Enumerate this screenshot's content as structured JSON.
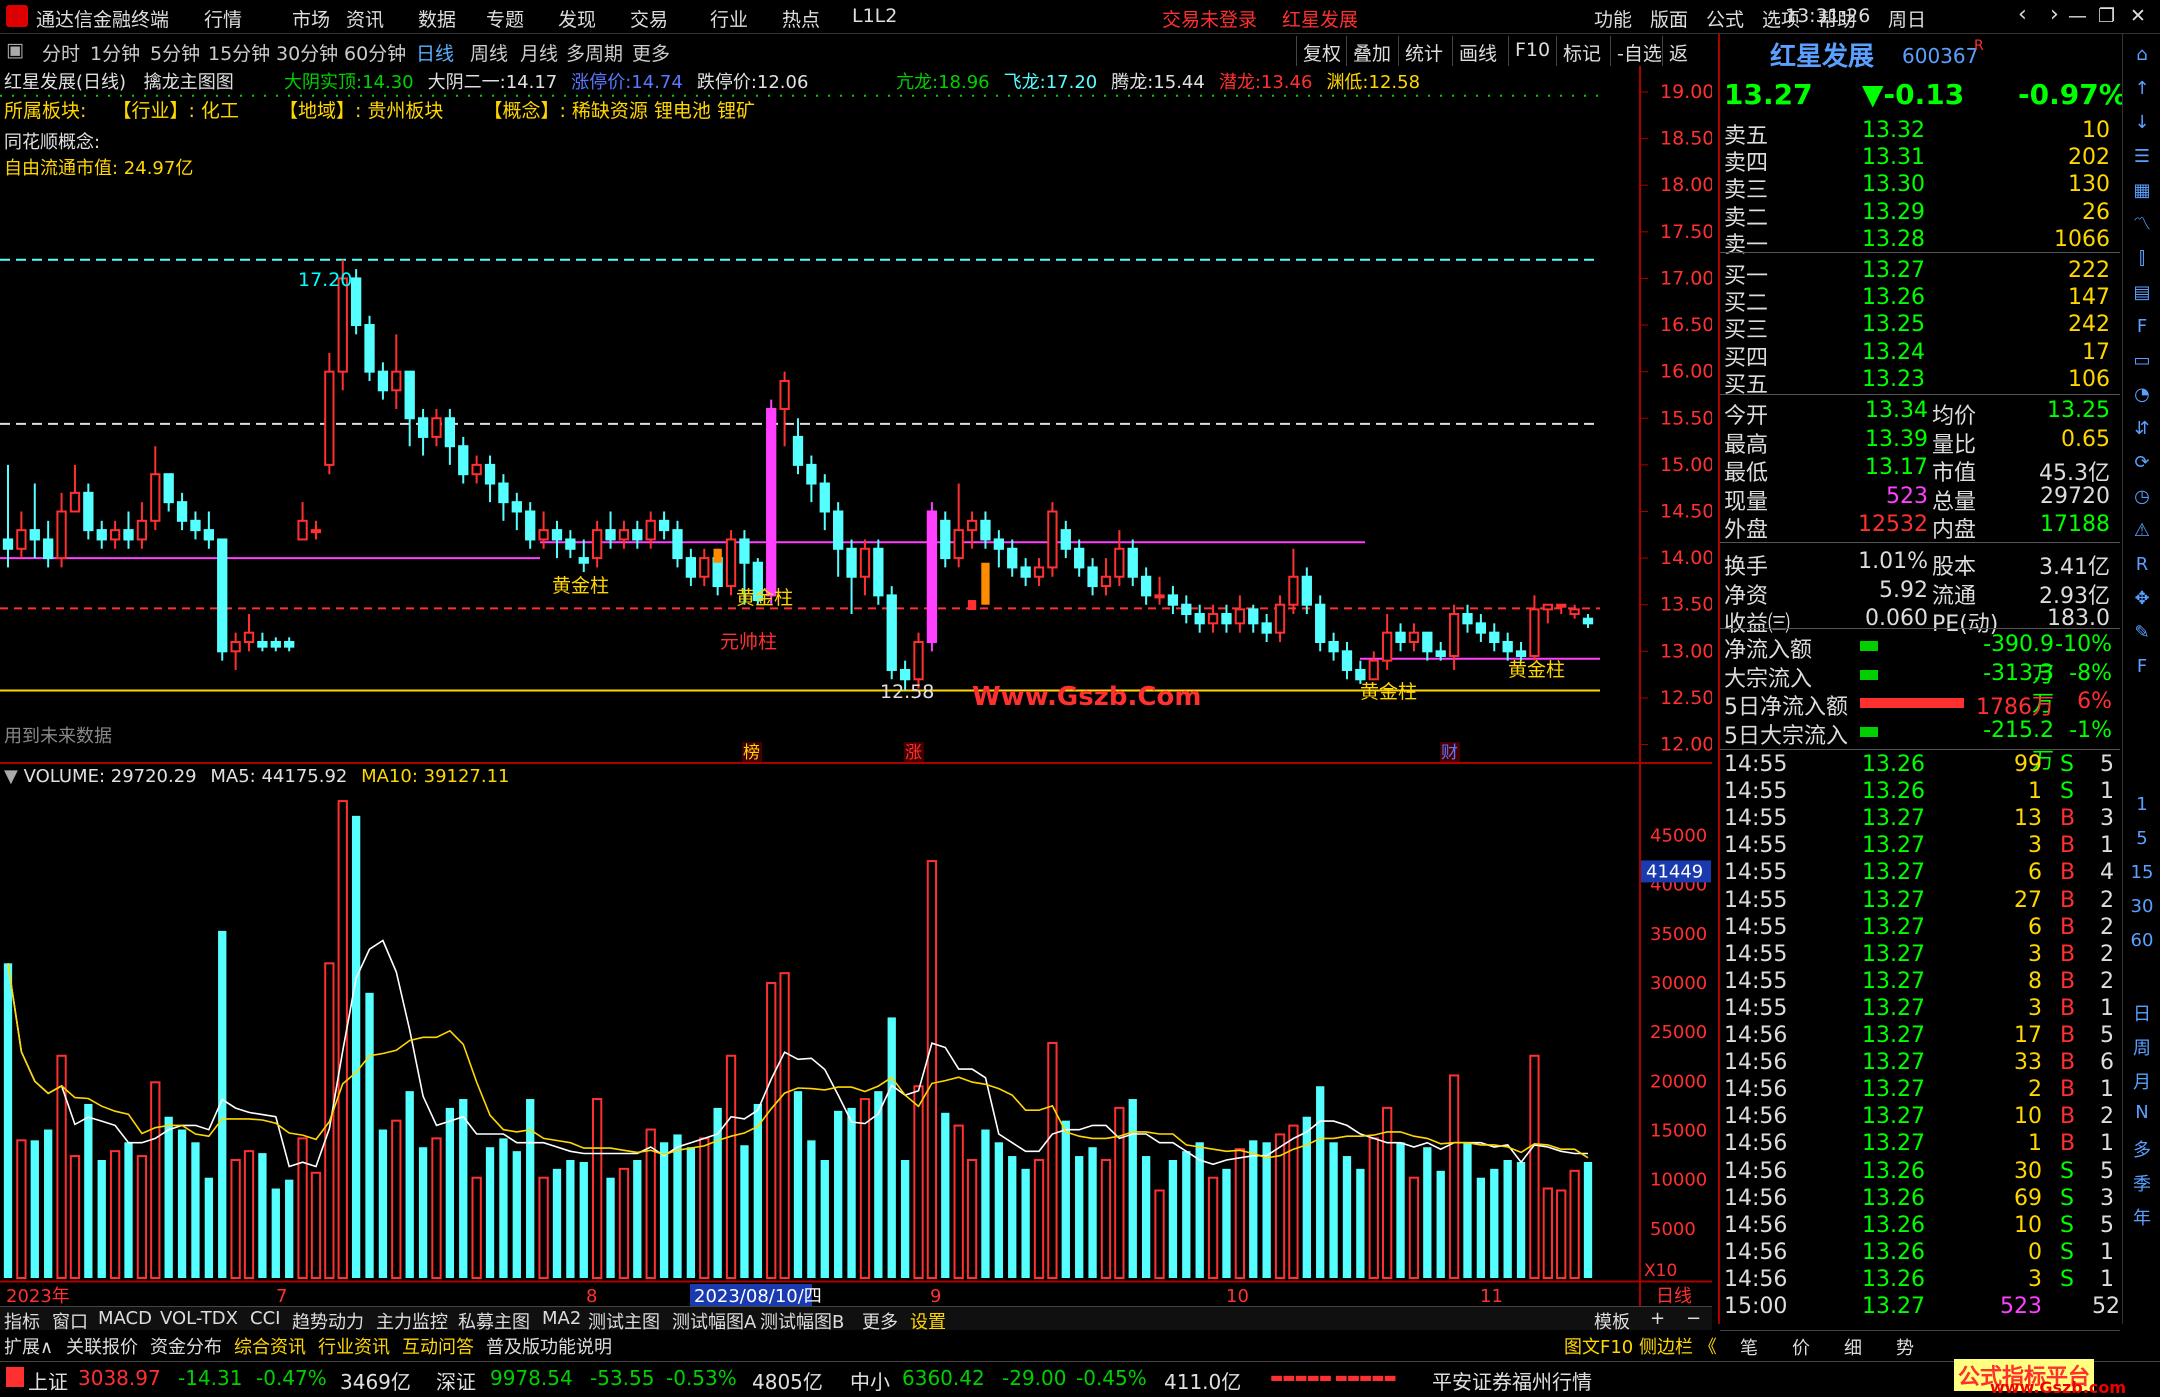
{
  "app": {
    "title": "通达信金融终端",
    "menu": [
      "行情",
      "市场",
      "资讯",
      "数据",
      "专题",
      "发现",
      "交易",
      "行业",
      "热点",
      "L1L2"
    ],
    "login": "交易未登录",
    "stock_tag": "红星发展",
    "right_menu": [
      "功能",
      "版面",
      "公式",
      "选项",
      "帮助"
    ],
    "time": "13:31:26",
    "weekday": "周日"
  },
  "toolbar": {
    "periods": [
      "分时",
      "1分钟",
      "5分钟",
      "15分钟",
      "30分钟",
      "60分钟",
      "日线",
      "周线",
      "月线",
      "多周期",
      "更多"
    ],
    "active": "日线",
    "right": [
      "复权",
      "叠加",
      "统计",
      "画线",
      "F10",
      "标记",
      "-自选",
      "返回"
    ]
  },
  "info": {
    "stock": "红星发展(日线)",
    "mode": "擒龙主图图",
    "line1": [
      {
        "t": "大阴实顶:",
        "v": "14.30",
        "c": "g"
      },
      {
        "t": "大阴二一:",
        "v": "14.17",
        "c": "w"
      },
      {
        "t": "涨停价:",
        "v": "14.74",
        "c": "b"
      },
      {
        "t": "跌停价:",
        "v": "12.06",
        "c": "w"
      }
    ],
    "line1b": [
      {
        "t": "亢龙:",
        "v": "18.96",
        "c": "g"
      },
      {
        "t": "飞龙:",
        "v": "17.20",
        "c": "c"
      },
      {
        "t": "腾龙:",
        "v": "15.44",
        "c": "w"
      },
      {
        "t": "潜龙:",
        "v": "13.46",
        "c": "r"
      },
      {
        "t": "渊低:",
        "v": "12.58",
        "c": "y"
      }
    ],
    "sector_label": "所属板块:",
    "industry": "【行业】: 化工",
    "region": "【地域】: 贵州板块",
    "concept": "【概念】: 稀缺资源 锂电池 锂矿",
    "ths": "同花顺概念:",
    "float_mv": "自由流通市值: 24.97亿",
    "future": "用到未来数据"
  },
  "chart_data": {
    "type": "candlestick",
    "y_ticks": [
      "19.00",
      "18.50",
      "18.00",
      "17.50",
      "17.00",
      "16.50",
      "16.00",
      "15.50",
      "15.00",
      "14.50",
      "14.00",
      "13.50",
      "13.00",
      "12.50",
      "12.00"
    ],
    "ylim": [
      11.92,
      19.15
    ],
    "annotations": [
      "17.20",
      "12.58",
      "黄金柱",
      "黄金柱",
      "元帅柱",
      "黄金柱",
      "黄金柱"
    ],
    "markers": [
      "榜",
      "涨",
      "财"
    ],
    "watermark": "Www.Gszb.Com",
    "volume": {
      "label": "VOLUME: 29720.29",
      "ma5": "MA5: 44175.92",
      "ma10": "MA10: 39127.11",
      "ticks": [
        "45000",
        "40000",
        "35000",
        "30000",
        "25000",
        "20000",
        "15000",
        "10000",
        "5000"
      ],
      "cursor_value": "41449",
      "scale": "X10",
      "ylim": [
        0,
        48000
      ]
    },
    "x_labels": [
      "2023年",
      "7",
      "8",
      "2023/08/10/四",
      "9",
      "10",
      "11",
      "日线"
    ]
  },
  "quote": {
    "name": "红星发展",
    "code": "600367",
    "tag": "R",
    "price": "13.27",
    "change": "▼-0.13",
    "pct": "-0.97%",
    "asks": [
      {
        "l": "卖五",
        "p": "13.32",
        "v": "10"
      },
      {
        "l": "卖四",
        "p": "13.31",
        "v": "202"
      },
      {
        "l": "卖三",
        "p": "13.30",
        "v": "130"
      },
      {
        "l": "卖二",
        "p": "13.29",
        "v": "26"
      },
      {
        "l": "卖一",
        "p": "13.28",
        "v": "1066"
      }
    ],
    "bids": [
      {
        "l": "买一",
        "p": "13.27",
        "v": "222"
      },
      {
        "l": "买二",
        "p": "13.26",
        "v": "147"
      },
      {
        "l": "买三",
        "p": "13.25",
        "v": "242"
      },
      {
        "l": "买四",
        "p": "13.24",
        "v": "17"
      },
      {
        "l": "买五",
        "p": "13.23",
        "v": "106"
      }
    ],
    "stats": [
      [
        "今开",
        "13.34",
        "均价",
        "13.25"
      ],
      [
        "最高",
        "13.39",
        "量比",
        "0.65"
      ],
      [
        "最低",
        "13.17",
        "市值",
        "45.3亿"
      ],
      [
        "现量",
        "523",
        "总量",
        "29720"
      ],
      [
        "外盘",
        "12532",
        "内盘",
        "17188"
      ],
      [
        "换手",
        "1.01%",
        "股本",
        "3.41亿"
      ],
      [
        "净资",
        "5.92",
        "流通",
        "2.93亿"
      ],
      [
        "收益㈢",
        "0.060",
        "PE(动)",
        "183.0"
      ]
    ],
    "flows": [
      [
        "净流入额",
        "-390.9万",
        "-10%"
      ],
      [
        "大宗流入",
        "-313.3万",
        "-8%"
      ],
      [
        "5日净流入额",
        "1786万",
        "6%"
      ],
      [
        "5日大宗流入",
        "-215.2万",
        "-1%"
      ]
    ],
    "ticks": [
      [
        "14:55",
        "13.26",
        "99",
        "S",
        "5"
      ],
      [
        "14:55",
        "13.26",
        "1",
        "S",
        "1"
      ],
      [
        "14:55",
        "13.27",
        "13",
        "B",
        "3"
      ],
      [
        "14:55",
        "13.27",
        "3",
        "B",
        "1"
      ],
      [
        "14:55",
        "13.27",
        "6",
        "B",
        "4"
      ],
      [
        "14:55",
        "13.27",
        "27",
        "B",
        "2"
      ],
      [
        "14:55",
        "13.27",
        "6",
        "B",
        "2"
      ],
      [
        "14:55",
        "13.27",
        "3",
        "B",
        "2"
      ],
      [
        "14:55",
        "13.27",
        "8",
        "B",
        "2"
      ],
      [
        "14:55",
        "13.27",
        "3",
        "B",
        "1"
      ],
      [
        "14:56",
        "13.27",
        "17",
        "B",
        "5"
      ],
      [
        "14:56",
        "13.27",
        "33",
        "B",
        "6"
      ],
      [
        "14:56",
        "13.27",
        "2",
        "B",
        "1"
      ],
      [
        "14:56",
        "13.27",
        "10",
        "B",
        "2"
      ],
      [
        "14:56",
        "13.27",
        "1",
        "B",
        "1"
      ],
      [
        "14:56",
        "13.26",
        "30",
        "S",
        "5"
      ],
      [
        "14:56",
        "13.26",
        "69",
        "S",
        "3"
      ],
      [
        "14:56",
        "13.26",
        "10",
        "S",
        "5"
      ],
      [
        "14:56",
        "13.26",
        "0",
        "S",
        "1"
      ],
      [
        "14:56",
        "13.26",
        "3",
        "S",
        "1"
      ],
      [
        "15:00",
        "13.27",
        "523",
        "",
        ""
      ]
    ],
    "tick_last_num": "52",
    "bottom_tabs": [
      "笔",
      "价",
      "细",
      "势"
    ]
  },
  "indicator_tabs": [
    "指标",
    "窗口",
    "MACD",
    "VOL-TDX",
    "CCI",
    "趋势动力",
    "主力监控",
    "私募主图",
    "MA2",
    "测试主图",
    "测试幅图A",
    "测试幅图B",
    "更多",
    "设置"
  ],
  "template_btn": "模板",
  "bottom_tabs2": [
    "扩展∧",
    "关联报价",
    "资金分布",
    "综合资讯",
    "行业资讯",
    "互动问答",
    "普及版功能说明"
  ],
  "bottom_right": "图文F10 侧边栏 《",
  "status": {
    "sh": "上证",
    "sh_v": "3038.97",
    "sh_c": "-14.31",
    "sh_p": "-0.47%",
    "sh_a": "3469亿",
    "sz": "深证",
    "sz_v": "9978.54",
    "sz_c": "-53.55",
    "sz_p": "-0.53%",
    "sz_a": "4805亿",
    "zx": "中小",
    "zx_v": "6360.42",
    "zx_c": "-29.00",
    "zx_p": "-0.45%",
    "zx_a": "411.0亿",
    "broker": "平安证券福州行情",
    "brand": "公式指标平台",
    "brand_url": "www.Gszb.com"
  },
  "sidebar": [
    "日",
    "周",
    "月",
    "N",
    "多",
    "季",
    "年",
    "1",
    "5",
    "15",
    "30",
    "60"
  ],
  "colors": {
    "up": "#ff3030",
    "down": "#55ffff",
    "ma5": "#ffffff",
    "ma10": "#ffd700",
    "bg": "#000000"
  }
}
